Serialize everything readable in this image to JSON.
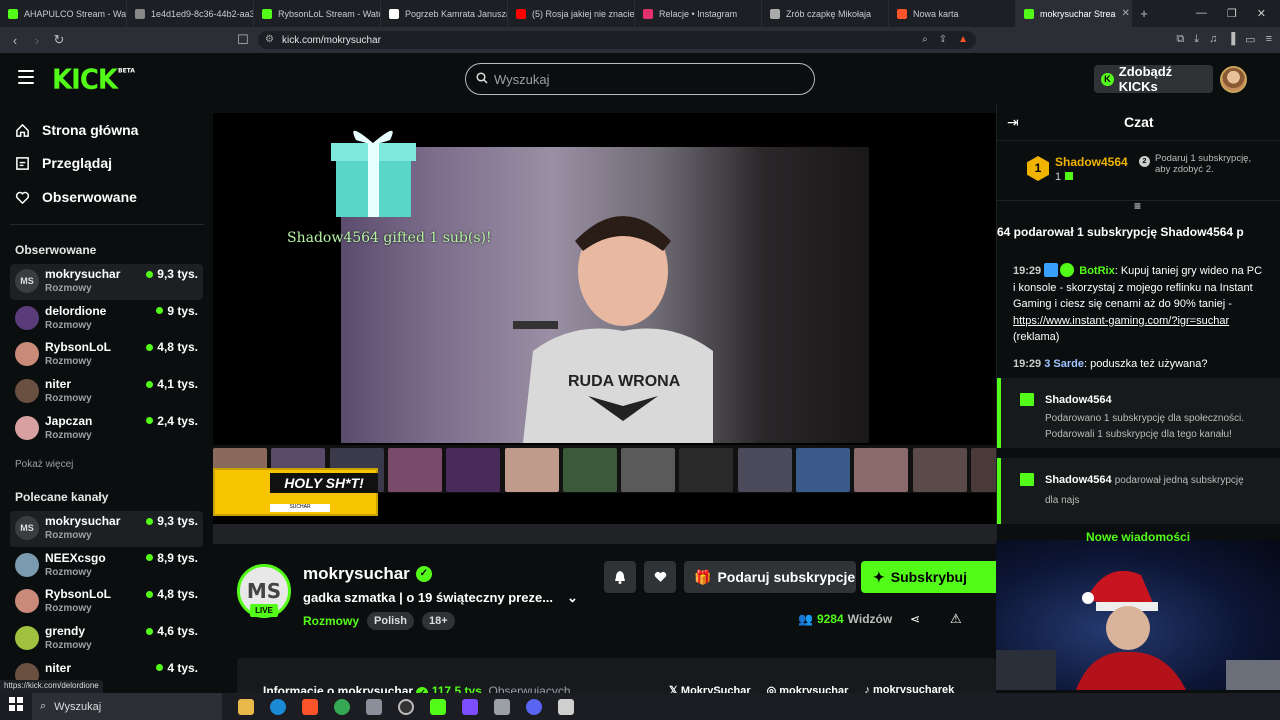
{
  "browser": {
    "tabs": [
      {
        "title": "AHAPULCO Stream - Watc",
        "color": "#53fc18"
      },
      {
        "title": "1e4d1ed9-8c36-44b2-aa3",
        "color": "#888888"
      },
      {
        "title": "RybsonLoL Stream - Watc",
        "color": "#53fc18"
      },
      {
        "title": "Pogrzeb Kamrata Janusza",
        "color": "#ffffff"
      },
      {
        "title": "(5) Rosja jakiej nie znacie",
        "color": "#ff0000"
      },
      {
        "title": "Relacje • Instagram",
        "color": "#e1306c"
      },
      {
        "title": "Zrób czapkę Mikołaja",
        "color": "#aaaaaa"
      },
      {
        "title": "Nowa karta",
        "color": "#fb542b"
      }
    ],
    "active_tab": "mokrysuchar Strea",
    "url": "kick.com/mokrysuchar",
    "status_url": "https://kick.com/delordione"
  },
  "header": {
    "logo": "KICK",
    "logo_badge": "BETA",
    "search_placeholder": "Wyszukaj",
    "kicks_button": "Zdobądź KICKs"
  },
  "sidebar": {
    "nav": [
      {
        "label": "Strona główna",
        "icon": "home-icon"
      },
      {
        "label": "Przeglądaj",
        "icon": "browse-icon"
      },
      {
        "label": "Obserwowane",
        "icon": "heart-icon"
      }
    ],
    "followed_title": "Obserwowane",
    "followed": [
      {
        "name": "mokrysuchar",
        "category": "Rozmowy",
        "viewers": "9,3 tys.",
        "color": "#3a3d40",
        "initials": "MS"
      },
      {
        "name": "delordione",
        "category": "Rozmowy",
        "viewers": "9 tys.",
        "color": "#5a3c7a"
      },
      {
        "name": "RybsonLoL",
        "category": "Rozmowy",
        "viewers": "4,8 tys.",
        "color": "#c98a7a"
      },
      {
        "name": "niter",
        "category": "Rozmowy",
        "viewers": "4,1 tys.",
        "color": "#6a5040"
      },
      {
        "name": "Japczan",
        "category": "Rozmowy",
        "viewers": "2,4 tys.",
        "color": "#d8a0a0"
      }
    ],
    "show_more": "Pokaż więcej",
    "recommended_title": "Polecane kanały",
    "recommended": [
      {
        "name": "mokrysuchar",
        "category": "Rozmowy",
        "viewers": "9,3 tys.",
        "color": "#3a3d40",
        "initials": "MS"
      },
      {
        "name": "NEEXcsgo",
        "category": "Rozmowy",
        "viewers": "8,9 tys.",
        "color": "#7a9ab0"
      },
      {
        "name": "RybsonLoL",
        "category": "Rozmowy",
        "viewers": "4,8 tys.",
        "color": "#c98a7a"
      },
      {
        "name": "grendy",
        "category": "Rozmowy",
        "viewers": "4,6 tys.",
        "color": "#a0c040"
      },
      {
        "name": "niter",
        "category": "",
        "viewers": "4 tys.",
        "color": "#6a5040"
      }
    ]
  },
  "video": {
    "gift_overlay": "Shadow4564 gifted 1 sub(s)!",
    "banner_title": "HOLY SH*T!",
    "banner_sub": "SUCHAR"
  },
  "channel": {
    "initials": "MS",
    "live": "LIVE",
    "name": "mokrysuchar",
    "title": "gadka szmatka | o 19 świąteczny preze...",
    "category": "Rozmowy",
    "tags": [
      "Polish",
      "18+"
    ],
    "gift_button": "Podaruj subskrypcje",
    "subscribe_button": "Subskrybuj",
    "viewers_count": "9284",
    "viewers_label": "Widzów",
    "about_title": "Informacje o mokrysuchar",
    "followers": "117,5 tys.",
    "followers_label": "Obserwujących",
    "socials": [
      "MokrySuchar",
      "mokrysuchar",
      "mokrysucharek"
    ]
  },
  "chat": {
    "title": "Czat",
    "pinned": {
      "rank": "1",
      "user": "Shadow4564",
      "count": "1",
      "note": "Podaruj 1 subskrypcję, aby zdobyć 2.",
      "note_rank": "2"
    },
    "ticker": "64 podarował 1 subskrypcję   Shadow4564 p",
    "messages": [
      {
        "time": "19:29",
        "user": "BotRix",
        "color": "#53fc18",
        "text": "Kupuj taniej gry wideo na PC i konsole - skorzystaj z mojego reflinku na Instant Gaming i ciesz się cenami aż do 90% taniej - ",
        "link": "https://www.instant-gaming.com/?igr=suchar",
        "suffix": " (reklama)"
      },
      {
        "time": "19:29",
        "user": "Sarde",
        "color": "#9ec5ff",
        "badge": "3",
        "text": "poduszka też używana?"
      }
    ],
    "sub_events": [
      {
        "user": "Shadow4564",
        "text": "Podarowano 1 subskrypcję dla społeczności. Podarowali 1 subskrypcję dla tego kanału!"
      },
      {
        "user": "Shadow4564",
        "inline": "podarował jedną subskrypcję",
        "text": "dla najs"
      }
    ],
    "new_messages": "Nowe wiadomości"
  },
  "taskbar": {
    "search": "Wyszukaj"
  }
}
